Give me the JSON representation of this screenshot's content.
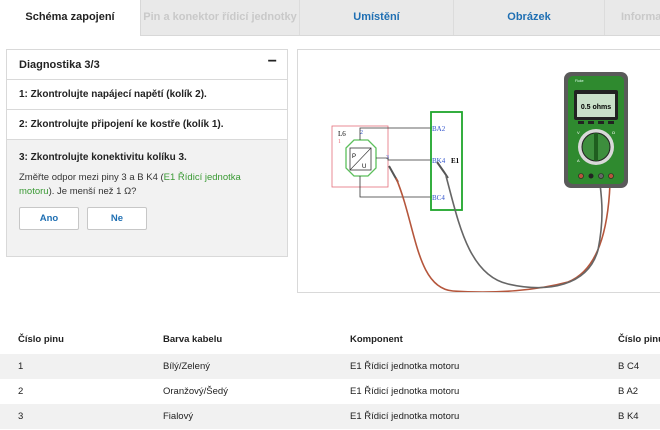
{
  "tabs": [
    {
      "label": "Schéma zapojení",
      "state": "active"
    },
    {
      "label": "Pin a konektor řídicí jednotky",
      "state": "disabled"
    },
    {
      "label": "Umístění",
      "state": "link"
    },
    {
      "label": "Obrázek",
      "state": "link"
    },
    {
      "label": "Informa",
      "state": "disabled"
    }
  ],
  "diagnostics": {
    "title": "Diagnostika 3/3",
    "collapse_symbol": "−",
    "steps": [
      "1: Zkontrolujte napájecí napětí (kolík 2).",
      "2: Zkontrolujte připojení ke kostře (kolík 1)."
    ],
    "active_step": {
      "title": "3: Zkontrolujte konektivitu kolíku 3.",
      "desc_before": "Změřte odpor mezi piny 3 a B K4 (",
      "desc_link": "E1 Řídicí jednotka motoru",
      "desc_after": "). Je menší než 1 Ω?",
      "yes": "Ano",
      "no": "Ne"
    }
  },
  "diagram": {
    "sensor_label": "L6",
    "sensor_pin_1": "1",
    "sensor_pin_2": "2",
    "sensor_pin_3": "3",
    "sensor_p": "P",
    "sensor_u": "U",
    "ecu_label": "E1",
    "ecu_pins": [
      "BA2",
      "BK4",
      "BC4"
    ],
    "meter_reading": "0.5 ohms",
    "meter_brand": "Fluke",
    "colors": {
      "ecu_green": "#1fa62b",
      "sensor_pink": "#e46f7a",
      "pin_blue": "#3355cc",
      "lead_red": "#b5563c",
      "lead_gray": "#666666",
      "meter_green": "#2f8a2f"
    }
  },
  "table": {
    "headers": [
      "Číslo pinu",
      "Barva kabelu",
      "Komponent",
      "Číslo pinu"
    ],
    "rows": [
      [
        "1",
        "Bílý/Zelený",
        "E1 Řídicí jednotka motoru",
        "B C4"
      ],
      [
        "2",
        "Oranžový/Šedý",
        "E1 Řídicí jednotka motoru",
        "B A2"
      ],
      [
        "3",
        "Fialový",
        "E1 Řídicí jednotka motoru",
        "B K4"
      ]
    ]
  }
}
